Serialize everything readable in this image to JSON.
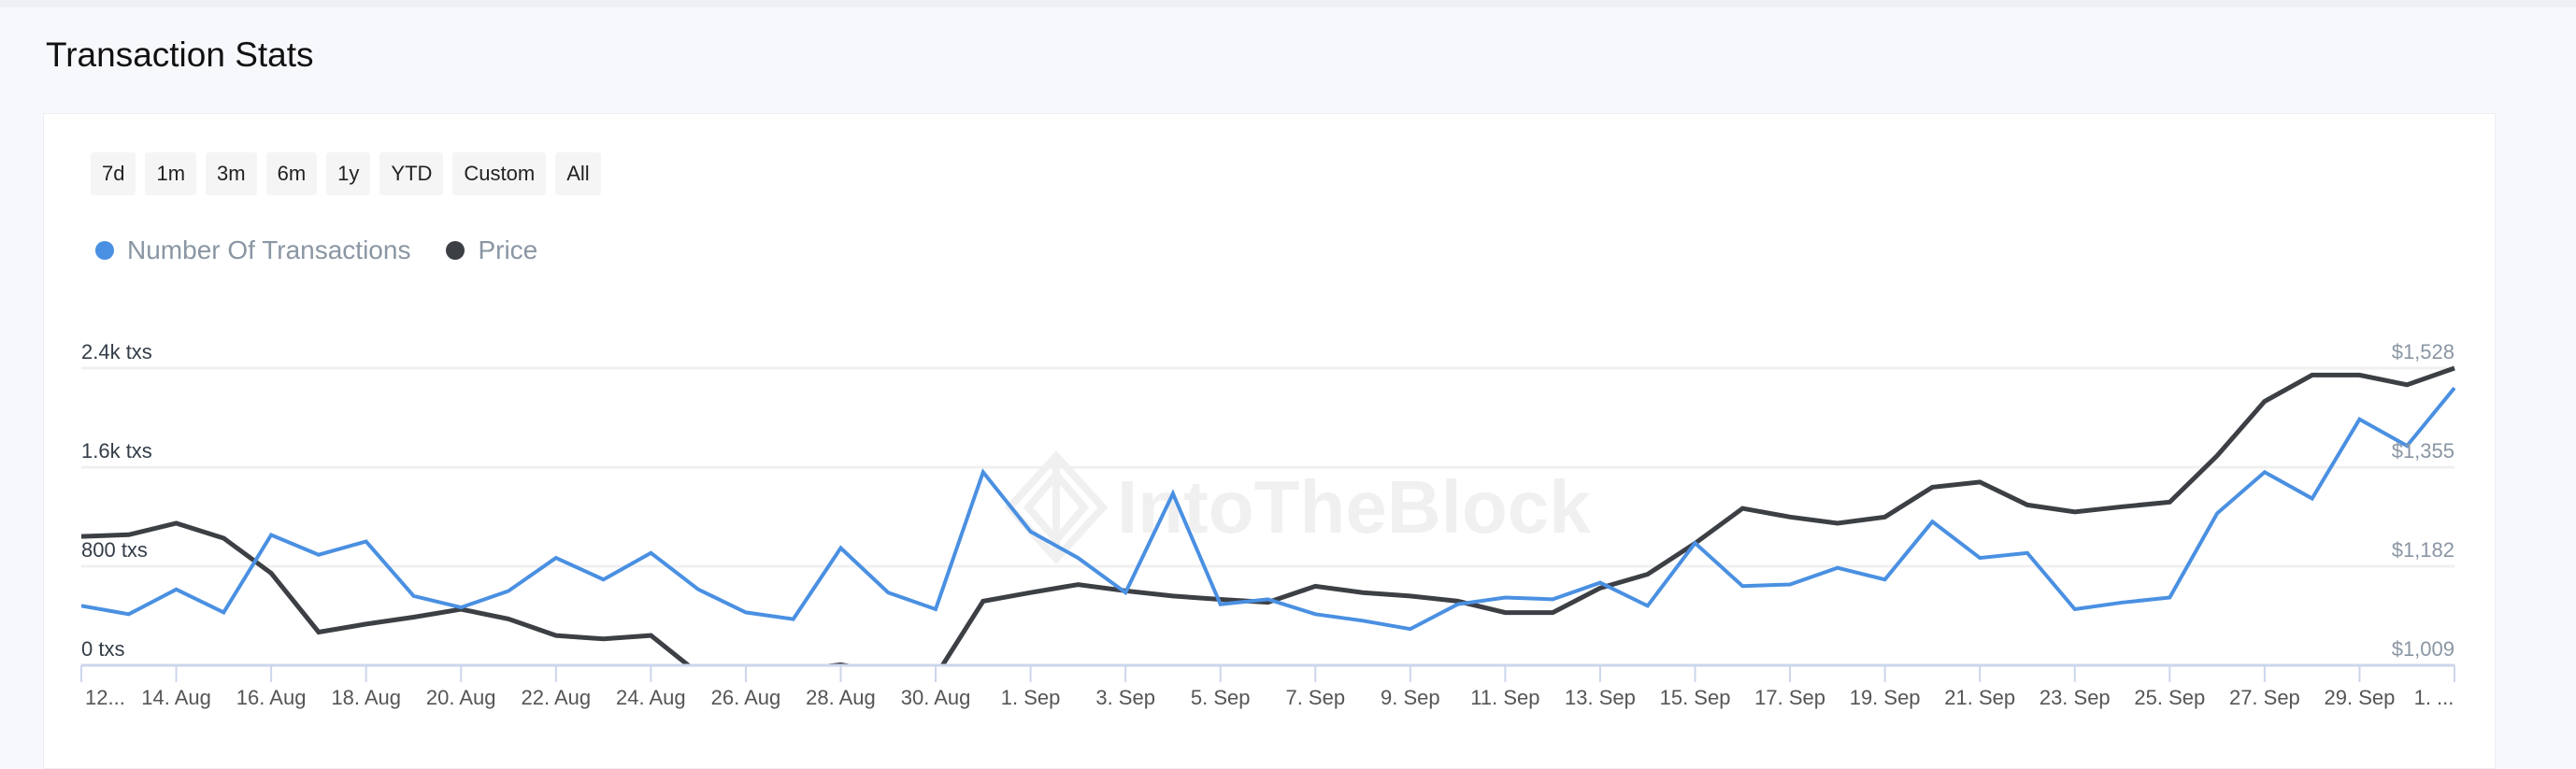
{
  "page": {
    "title": "Transaction Stats"
  },
  "range_buttons": [
    "7d",
    "1m",
    "3m",
    "6m",
    "1y",
    "YTD",
    "Custom",
    "All"
  ],
  "watermark": "IntoTheBlock",
  "chart_data": {
    "type": "line",
    "x": [
      "12 Aug",
      "13 Aug",
      "14 Aug",
      "15 Aug",
      "16 Aug",
      "17 Aug",
      "18 Aug",
      "19 Aug",
      "20 Aug",
      "21 Aug",
      "22 Aug",
      "23 Aug",
      "24 Aug",
      "25 Aug",
      "26 Aug",
      "27 Aug",
      "28 Aug",
      "29 Aug",
      "30 Aug",
      "31 Aug",
      "1 Sep",
      "2 Sep",
      "3 Sep",
      "4 Sep",
      "5 Sep",
      "6 Sep",
      "7 Sep",
      "8 Sep",
      "9 Sep",
      "10 Sep",
      "11 Sep",
      "12 Sep",
      "13 Sep",
      "14 Sep",
      "15 Sep",
      "16 Sep",
      "17 Sep",
      "18 Sep",
      "19 Sep",
      "20 Sep",
      "21 Sep",
      "22 Sep",
      "23 Sep",
      "24 Sep",
      "25 Sep",
      "26 Sep",
      "27 Sep",
      "28 Sep",
      "29 Sep",
      "30 Sep",
      "1 Oct"
    ],
    "x_tick_labels": [
      "12...",
      "14. Aug",
      "16. Aug",
      "18. Aug",
      "20. Aug",
      "22. Aug",
      "24. Aug",
      "26. Aug",
      "28. Aug",
      "30. Aug",
      "1. Sep",
      "3. Sep",
      "5. Sep",
      "7. Sep",
      "9. Sep",
      "11. Sep",
      "13. Sep",
      "15. Sep",
      "17. Sep",
      "19. Sep",
      "21. Sep",
      "23. Sep",
      "25. Sep",
      "27. Sep",
      "29. Sep",
      "1. ..."
    ],
    "y_left": {
      "ticks": [
        0,
        800,
        1600,
        2400
      ],
      "tick_labels": [
        "0 txs",
        "800 txs",
        "1.6k txs",
        "2.4k txs"
      ],
      "range": [
        0,
        2400
      ]
    },
    "y_right": {
      "ticks": [
        1009,
        1182,
        1355,
        1528
      ],
      "tick_labels": [
        "$1,009",
        "$1,182",
        "$1,355",
        "$1,528"
      ],
      "range": [
        1009,
        1528
      ]
    },
    "grid": true,
    "legend_placement": "top-left",
    "series": [
      {
        "name": "Number Of Transactions",
        "axis": "left",
        "color": "#4a90e2",
        "values": [
          480,
          413,
          613,
          427,
          1053,
          893,
          1000,
          560,
          467,
          600,
          867,
          693,
          907,
          613,
          427,
          373,
          947,
          587,
          453,
          1560,
          1080,
          867,
          587,
          1387,
          493,
          533,
          413,
          360,
          293,
          493,
          547,
          533,
          667,
          480,
          987,
          640,
          653,
          787,
          693,
          1160,
          867,
          907,
          453,
          507,
          547,
          1227,
          1560,
          1347,
          1987,
          1773,
          2240
        ]
      },
      {
        "name": "Price",
        "axis": "right",
        "color": "#3c3f44",
        "values": [
          1234,
          1237,
          1257,
          1231,
          1170,
          1067,
          1081,
          1093,
          1107,
          1090,
          1061,
          1055,
          1061,
          995,
          990,
          1000,
          1010,
          995,
          990,
          1121,
          1136,
          1150,
          1139,
          1130,
          1124,
          1119,
          1147,
          1136,
          1130,
          1121,
          1101,
          1101,
          1144,
          1168,
          1222,
          1283,
          1268,
          1257,
          1268,
          1320,
          1329,
          1289,
          1277,
          1286,
          1294,
          1375,
          1470,
          1516,
          1516,
          1499,
          1528
        ]
      }
    ]
  }
}
